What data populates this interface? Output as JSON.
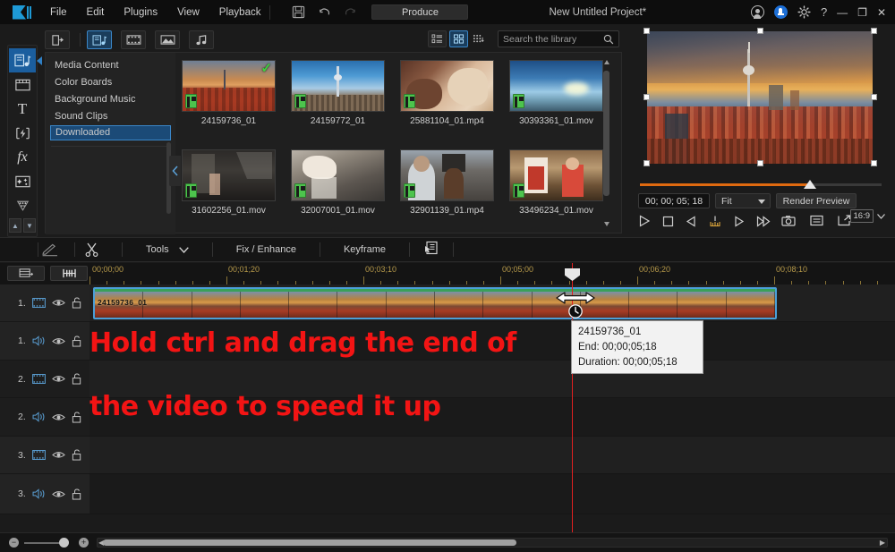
{
  "app": {
    "logo": "powerdirector-logo",
    "project_title": "New Untitled Project*",
    "produce_label": "Produce"
  },
  "menubar": {
    "items": [
      {
        "label": "File"
      },
      {
        "label": "Edit"
      },
      {
        "label": "Plugins"
      },
      {
        "label": "View"
      },
      {
        "label": "Playback"
      }
    ],
    "icons": [
      "save-icon",
      "undo-icon",
      "redo-icon"
    ]
  },
  "window_controls": {
    "account_icon": "account-icon",
    "notifications_icon": "bell-icon",
    "settings_icon": "gear-icon",
    "help_label": "?",
    "minimize_label": "—",
    "maximize_label": "❐",
    "close_label": "✕"
  },
  "left_toolbar": {
    "items": [
      {
        "name": "media-room",
        "icon": "media-library-icon",
        "selected": true
      },
      {
        "name": "transition-room",
        "icon": "film-strip-icon",
        "selected": false
      },
      {
        "name": "title-room",
        "icon": "text-t-icon",
        "selected": false
      },
      {
        "name": "effect-room",
        "icon": "lightning-effect-icon",
        "selected": false
      },
      {
        "name": "fx-room",
        "icon": "fx-icon",
        "selected": false
      },
      {
        "name": "overlay-room",
        "icon": "sparkle-overlay-icon",
        "selected": false
      },
      {
        "name": "particle-room",
        "icon": "particle-icon",
        "selected": false
      }
    ],
    "nav_up": "▲",
    "nav_down": "▼"
  },
  "library": {
    "toolbar": {
      "import_icon": "import-media-icon",
      "filters": [
        {
          "name": "all-media-filter",
          "icon": "media-all-icon",
          "selected": true
        },
        {
          "name": "video-filter",
          "icon": "video-icon",
          "selected": false
        },
        {
          "name": "image-filter",
          "icon": "image-icon",
          "selected": false
        },
        {
          "name": "audio-filter",
          "icon": "audio-note-icon",
          "selected": false
        }
      ]
    },
    "view_modes": [
      {
        "name": "list-view",
        "icon": "list-view-icon",
        "selected": false
      },
      {
        "name": "grid-view",
        "icon": "grid-view-icon",
        "selected": true
      },
      {
        "name": "sort-view",
        "icon": "sort-dots-icon",
        "selected": false
      }
    ],
    "search": {
      "placeholder": "Search the library",
      "value": "",
      "icon": "search-icon"
    },
    "categories": [
      {
        "label": "Media Content",
        "selected": false
      },
      {
        "label": "Color Boards",
        "selected": false
      },
      {
        "label": "Background Music",
        "selected": false
      },
      {
        "label": "Sound Clips",
        "selected": false
      },
      {
        "label": "Downloaded",
        "selected": true
      }
    ],
    "collapse_icon": "chevron-left-icon",
    "media_items": [
      {
        "name": "24159736_01",
        "checked": true,
        "badge": "video-badge"
      },
      {
        "name": "24159772_01",
        "checked": false,
        "badge": "video-badge"
      },
      {
        "name": "25881104_01.mp4",
        "checked": false,
        "badge": "video-badge"
      },
      {
        "name": "30393361_01.mov",
        "checked": false,
        "badge": "video-badge"
      },
      {
        "name": "31602256_01.mov",
        "checked": false,
        "badge": "video-badge"
      },
      {
        "name": "32007001_01.mov",
        "checked": false,
        "badge": "video-badge"
      },
      {
        "name": "32901139_01.mp4",
        "checked": false,
        "badge": "video-badge"
      },
      {
        "name": "33496234_01.mov",
        "checked": false,
        "badge": "video-badge"
      }
    ]
  },
  "preview": {
    "timecode": "00; 00; 05; 18",
    "zoom_mode": "Fit",
    "render_label": "Render Preview",
    "aspect_ratio": "16:9",
    "scrub_percent": 70,
    "transport": [
      {
        "name": "play-button",
        "icon": "play-icon"
      },
      {
        "name": "stop-button",
        "icon": "stop-icon"
      },
      {
        "name": "previous-frame-button",
        "icon": "prev-frame-icon"
      },
      {
        "name": "cut-marker-button",
        "icon": "cut-marker-icon"
      },
      {
        "name": "next-frame-button",
        "icon": "next-frame-icon"
      },
      {
        "name": "fast-forward-button",
        "icon": "fast-forward-icon"
      }
    ],
    "utilities": [
      {
        "name": "snapshot-button",
        "icon": "camera-icon"
      },
      {
        "name": "display-options-button",
        "icon": "list-lines-icon"
      },
      {
        "name": "popout-preview-button",
        "icon": "popout-icon"
      }
    ]
  },
  "tools_bar": {
    "items": [
      {
        "label": "",
        "name": "pencil-tool",
        "icon": "pencil-icon"
      },
      {
        "label": "",
        "name": "split-tool",
        "icon": "scissors-icon"
      },
      {
        "label": "Tools",
        "name": "tools-menu",
        "icon": "chevron-down-icon"
      },
      {
        "label": "Fix / Enhance",
        "name": "fix-enhance-button",
        "icon": ""
      },
      {
        "label": "Keyframe",
        "name": "keyframe-button",
        "icon": ""
      },
      {
        "label": "",
        "name": "designer-button",
        "icon": "designer-icon"
      }
    ]
  },
  "timeline": {
    "header_buttons": [
      {
        "name": "track-manager-button",
        "icon": "track-manager-icon"
      },
      {
        "name": "marker-button",
        "icon": "marker-icon"
      }
    ],
    "ruler_labels": [
      "00;00;00",
      "00;01;20",
      "00;03;10",
      "00;05;00",
      "00;06;20",
      "00;08;10"
    ],
    "playhead_position": "00;05;00",
    "tracks": [
      {
        "num": "1.",
        "type": "video",
        "icon": "video-track-icon",
        "eye": "eye-icon",
        "lock": "unlock-icon"
      },
      {
        "num": "1.",
        "type": "audio",
        "icon": "audio-track-icon",
        "eye": "eye-icon",
        "lock": "unlock-icon"
      },
      {
        "num": "2.",
        "type": "video",
        "icon": "video-track-icon",
        "eye": "eye-icon",
        "lock": "unlock-icon"
      },
      {
        "num": "2.",
        "type": "audio",
        "icon": "audio-track-icon",
        "eye": "eye-icon",
        "lock": "unlock-icon"
      },
      {
        "num": "3.",
        "type": "video",
        "icon": "video-track-icon",
        "eye": "eye-icon",
        "lock": "unlock-icon"
      },
      {
        "num": "3.",
        "type": "audio",
        "icon": "audio-track-icon",
        "eye": "eye-icon",
        "lock": "unlock-icon"
      }
    ],
    "clip": {
      "label": "24159736_01"
    },
    "drag_cursor": "resize-horizontal-cursor",
    "speed_icon": "clock-icon"
  },
  "tooltip": {
    "title": "24159736_01",
    "end": "End: 00;00;05;18",
    "duration": "Duration: 00;00;05;18"
  },
  "annotation": {
    "line1": "Hold ctrl and drag the end of",
    "line2": "the video to speed it up",
    "color": "#f31414"
  },
  "bottom_bar": {
    "zoom_out": "−",
    "zoom_in": "+",
    "scroll_left_icon": "arrow-left-icon",
    "scroll_right_icon": "arrow-right-icon"
  },
  "colors": {
    "accent_blue": "#3a86c8",
    "selection_blue": "#1b4a77",
    "orange": "#e06a10",
    "playhead_red": "#e02020",
    "ruler_gold": "#b79a4a"
  }
}
